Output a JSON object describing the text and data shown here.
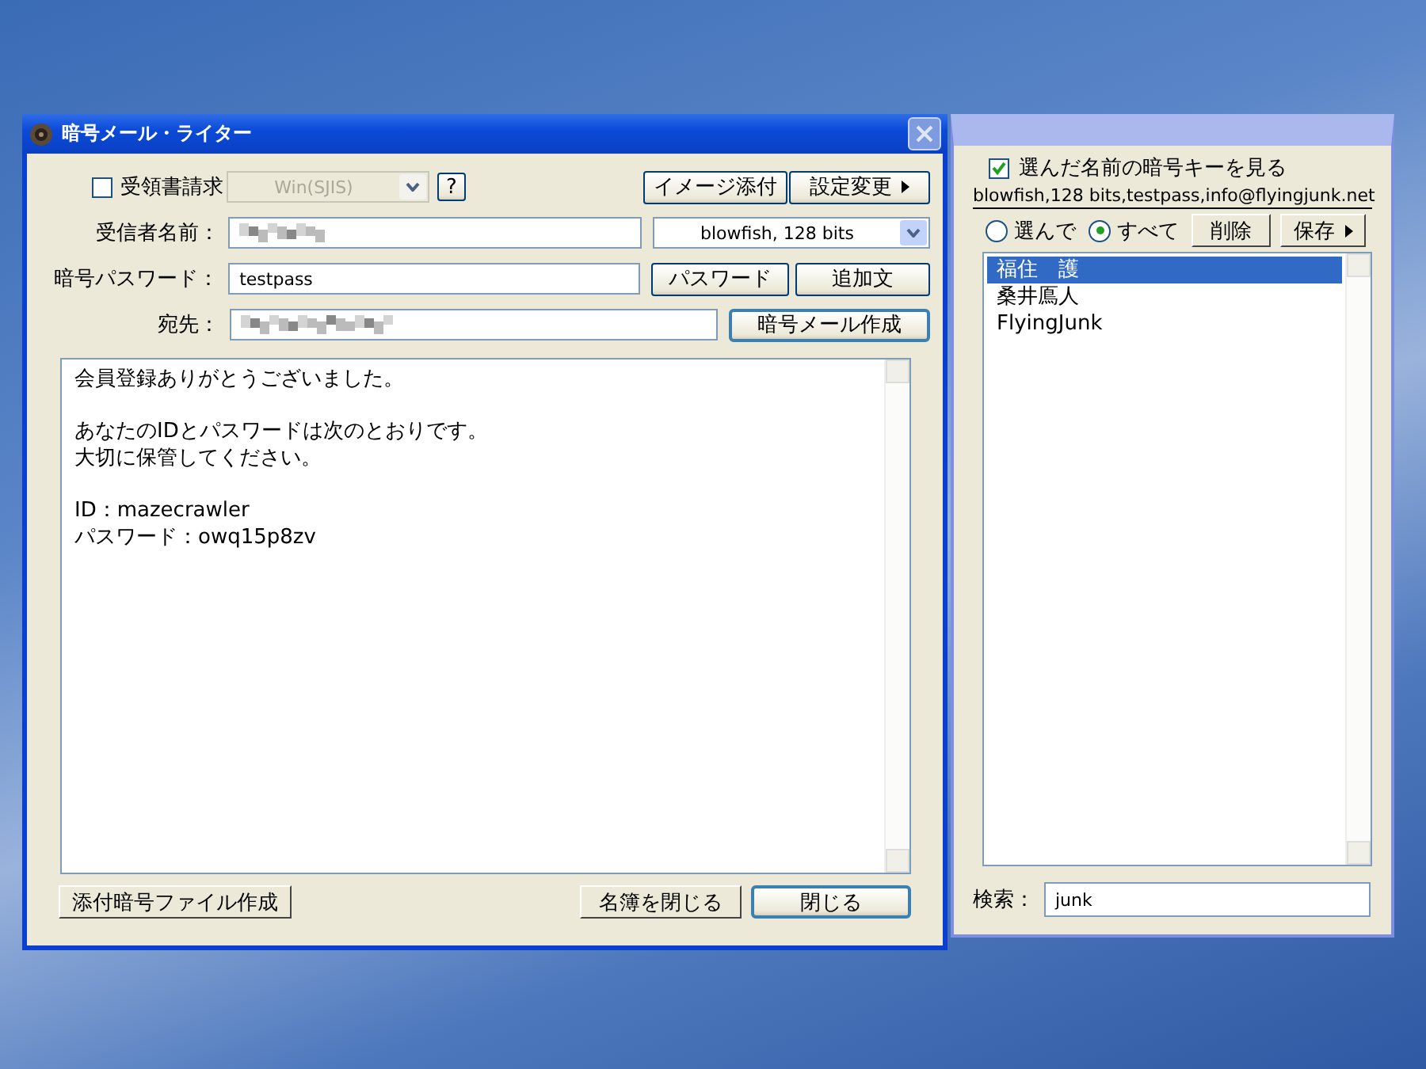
{
  "main_window": {
    "title": "暗号メール・ライター",
    "receipt_request": {
      "label": "受領書請求",
      "checked": false
    },
    "encoding": {
      "value": "Win(SJIS)",
      "disabled": true
    },
    "help_button": "?",
    "image_attach_button": "イメージ添付",
    "settings_button": "設定変更",
    "recipient_name": {
      "label": "受信者名前："
    },
    "cipher": {
      "value": "blowfish, 128 bits"
    },
    "password": {
      "label": "暗号パスワード：",
      "value": "testpass"
    },
    "password_button": "パスワード",
    "append_button": "追加文",
    "address": {
      "label": "宛先："
    },
    "create_button": "暗号メール作成",
    "body": [
      [
        "会員登録ありがとうございました。"
      ],
      [
        "あなたのIDとパスワードは次のとおりです。",
        "大切に保管してください。"
      ],
      [
        "ID：mazecrawler",
        "パスワード：owq15p8zv"
      ]
    ],
    "attach_file_button": "添付暗号ファイル作成",
    "close_list_button": "名簿を閉じる",
    "close_button": "閉じる"
  },
  "key_panel": {
    "show_keys": {
      "label": "選んだ名前の暗号キーを見る",
      "checked": true
    },
    "key_info": "blowfish,128 bits,testpass,info@flyingjunk.net",
    "scope": [
      {
        "label": "選んで",
        "selected": false
      },
      {
        "label": "すべて",
        "selected": true
      }
    ],
    "delete_button": "削除",
    "save_button": "保存",
    "names": [
      {
        "text": "福住　護",
        "selected": true
      },
      {
        "text": "桑井鳫人",
        "selected": false
      },
      {
        "text": "FlyingJunk",
        "selected": false
      }
    ],
    "search": {
      "label": "検索：",
      "value": "junk"
    }
  }
}
